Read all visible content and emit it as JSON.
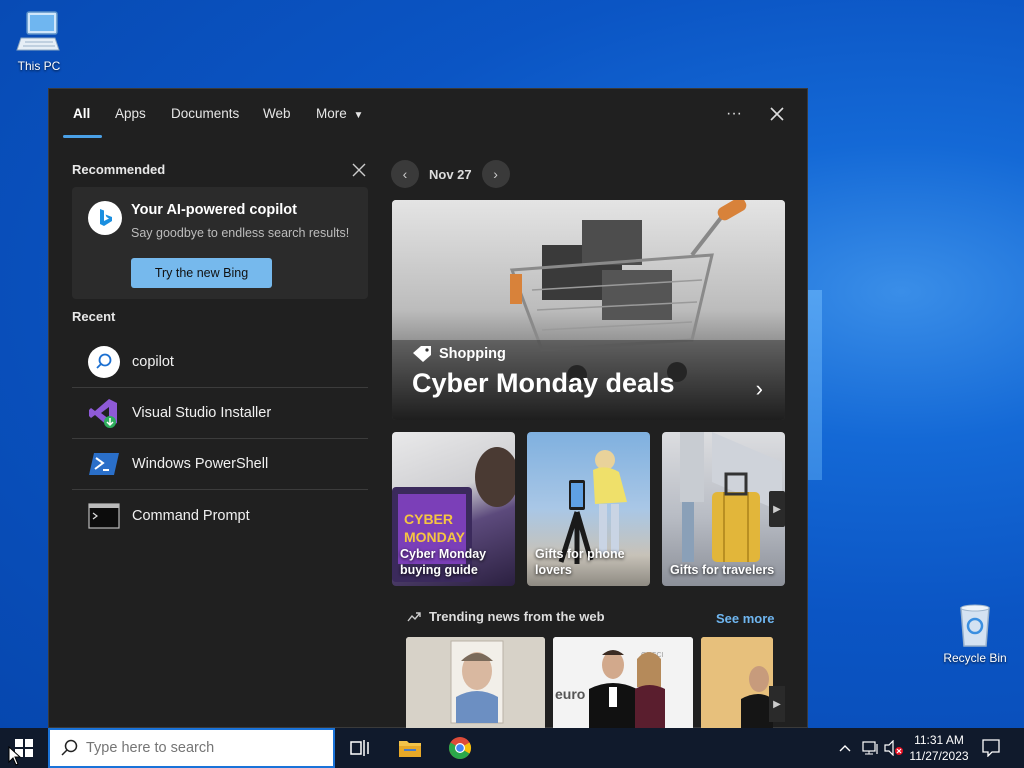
{
  "desktop": {
    "icons": [
      {
        "label": "This PC",
        "icon": "computer-icon"
      },
      {
        "label": "Recycle Bin",
        "icon": "recycle-bin-icon"
      }
    ]
  },
  "search_panel": {
    "tabs": [
      "All",
      "Apps",
      "Documents",
      "Web",
      "More"
    ],
    "active_tab": "All",
    "recommended": {
      "label": "Recommended",
      "card_title": "Your AI-powered copilot",
      "card_subtitle": "Say goodbye to endless search results!",
      "button_label": "Try the new Bing"
    },
    "recent": {
      "label": "Recent",
      "items": [
        {
          "label": "copilot",
          "icon": "search-icon"
        },
        {
          "label": "Visual Studio Installer",
          "icon": "visual-studio-icon"
        },
        {
          "label": "Windows PowerShell",
          "icon": "powershell-icon"
        },
        {
          "label": "Command Prompt",
          "icon": "cmd-icon"
        }
      ]
    },
    "date": "Nov 27",
    "hero": {
      "tag": "Shopping",
      "title": "Cyber Monday deals"
    },
    "tiles": [
      {
        "caption": "Cyber Monday buying guide"
      },
      {
        "caption": "Gifts for phone lovers"
      },
      {
        "caption": "Gifts for travelers"
      }
    ],
    "trending_label": "Trending news from the web",
    "see_more": "See more"
  },
  "taskbar": {
    "search_placeholder": "Type here to search",
    "time": "11:31 AM",
    "date": "11/27/2023"
  },
  "colors": {
    "accent": "#4aa0e6",
    "panel_bg": "#202020",
    "button_blue": "#76b9ed"
  }
}
